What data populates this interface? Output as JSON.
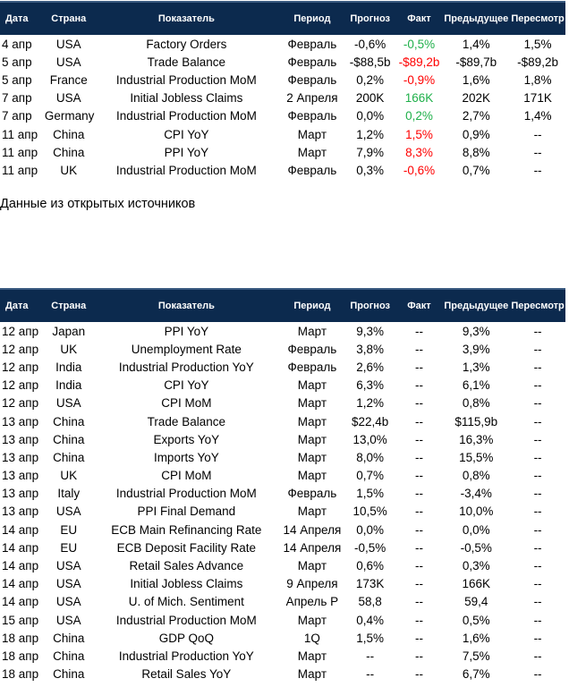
{
  "headers": [
    "Дата",
    "Страна",
    "Показатель",
    "Период",
    "Прогноз",
    "Факт",
    "Предыдущее",
    "Пересмотр"
  ],
  "colors": {
    "header_bg": "#0c2a4e",
    "positive": "#1fb04a",
    "negative": "#ff0000"
  },
  "table1": [
    [
      "4 апр",
      "USA",
      "Factory Orders",
      "Февраль",
      "-0,6%",
      "-0,5%",
      "1,4%",
      "1,5%",
      "green"
    ],
    [
      "5 апр",
      "USA",
      "Trade Balance",
      "Февраль",
      "-$88,5b",
      "-$89,2b",
      "-$89,7b",
      "-$89,2b",
      "red"
    ],
    [
      "5 апр",
      "France",
      "Industrial Production MoM",
      "Февраль",
      "0,2%",
      "-0,9%",
      "1,6%",
      "1,8%",
      "red"
    ],
    [
      "7 апр",
      "USA",
      "Initial Jobless Claims",
      "2 Апреля",
      "200K",
      "166K",
      "202K",
      "171K",
      "green"
    ],
    [
      "7 апр",
      "Germany",
      "Industrial Production MoM",
      "Февраль",
      "0,0%",
      "0,2%",
      "2,7%",
      "1,4%",
      "green"
    ],
    [
      "11 апр",
      "China",
      "CPI YoY",
      "Март",
      "1,2%",
      "1,5%",
      "0,9%",
      "--",
      "red"
    ],
    [
      "11 апр",
      "China",
      "PPI YoY",
      "Март",
      "7,9%",
      "8,3%",
      "8,8%",
      "--",
      "red"
    ],
    [
      "11 апр",
      "UK",
      "Industrial Production MoM",
      "Февраль",
      "0,3%",
      "-0,6%",
      "0,7%",
      "--",
      "red"
    ]
  ],
  "note": "Данные из открытых источников",
  "table2": [
    [
      "12 апр",
      "Japan",
      "PPI YoY",
      "Март",
      "9,3%",
      "--",
      "9,3%",
      "--"
    ],
    [
      "12 апр",
      "UK",
      "Unemployment Rate",
      "Февраль",
      "3,8%",
      "--",
      "3,9%",
      "--"
    ],
    [
      "12 апр",
      "India",
      "Industrial Production YoY",
      "Февраль",
      "2,6%",
      "--",
      "1,3%",
      "--"
    ],
    [
      "12 апр",
      "India",
      "CPI YoY",
      "Март",
      "6,3%",
      "--",
      "6,1%",
      "--"
    ],
    [
      "12 апр",
      "USA",
      "CPI MoM",
      "Март",
      "1,2%",
      "--",
      "0,8%",
      "--"
    ],
    [
      "13 апр",
      "China",
      "Trade Balance",
      "Март",
      "$22,4b",
      "--",
      "$115,9b",
      "--"
    ],
    [
      "13 апр",
      "China",
      "Exports YoY",
      "Март",
      "13,0%",
      "--",
      "16,3%",
      "--"
    ],
    [
      "13 апр",
      "China",
      "Imports YoY",
      "Март",
      "8,0%",
      "--",
      "15,5%",
      "--"
    ],
    [
      "13 апр",
      "UK",
      "CPI MoM",
      "Март",
      "0,7%",
      "--",
      "0,8%",
      "--"
    ],
    [
      "13 апр",
      "Italy",
      "Industrial Production MoM",
      "Февраль",
      "1,5%",
      "--",
      "-3,4%",
      "--"
    ],
    [
      "13 апр",
      "USA",
      "PPI Final Demand",
      "Март",
      "10,5%",
      "--",
      "10,0%",
      "--"
    ],
    [
      "14 апр",
      "EU",
      "ECB Main Refinancing Rate",
      "14 Апреля",
      "0,0%",
      "--",
      "0,0%",
      "--"
    ],
    [
      "14 апр",
      "EU",
      "ECB Deposit Facility Rate",
      "14 Апреля",
      "-0,5%",
      "--",
      "-0,5%",
      "--"
    ],
    [
      "14 апр",
      "USA",
      "Retail Sales Advance",
      "Март",
      "0,6%",
      "--",
      "0,3%",
      "--"
    ],
    [
      "14 апр",
      "USA",
      "Initial Jobless Claims",
      "9 Апреля",
      "173K",
      "--",
      "166K",
      "--"
    ],
    [
      "14 апр",
      "USA",
      "U. of Mich. Sentiment",
      "Апрель P",
      "58,8",
      "--",
      "59,4",
      "--"
    ],
    [
      "15 апр",
      "USA",
      "Industrial Production MoM",
      "Март",
      "0,4%",
      "--",
      "0,5%",
      "--"
    ],
    [
      "18 апр",
      "China",
      "GDP QoQ",
      "1Q",
      "1,5%",
      "--",
      "1,6%",
      "--"
    ],
    [
      "18 апр",
      "China",
      "Industrial Production YoY",
      "Март",
      "--",
      "--",
      "7,5%",
      "--"
    ],
    [
      "18 апр",
      "China",
      "Retail Sales YoY",
      "Март",
      "--",
      "--",
      "6,7%",
      "--"
    ]
  ]
}
